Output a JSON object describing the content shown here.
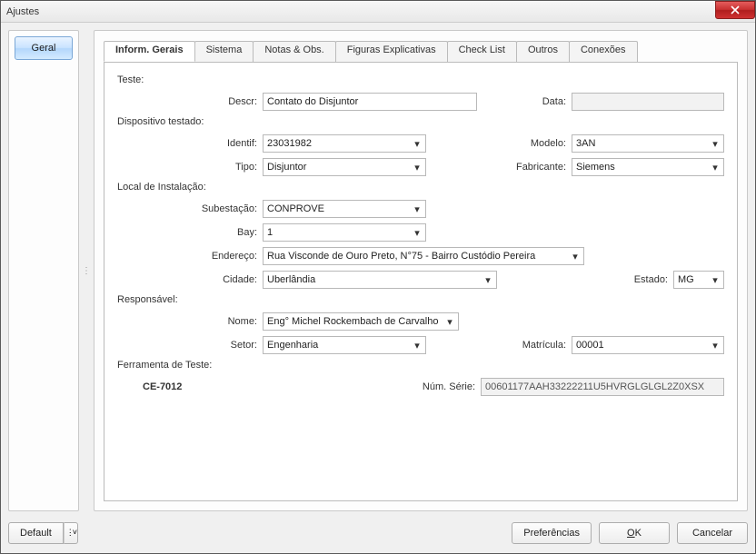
{
  "window": {
    "title": "Ajustes"
  },
  "sidebar": {
    "geral": "Geral"
  },
  "tabs": {
    "inform": "Inform. Gerais",
    "sistema": "Sistema",
    "notas": "Notas & Obs.",
    "figuras": "Figuras Explicativas",
    "check": "Check List",
    "outros": "Outros",
    "conexoes": "Conexões"
  },
  "form": {
    "teste_group": "Teste:",
    "descr_label": "Descr:",
    "descr_value": "Contato do Disjuntor",
    "data_label": "Data:",
    "data_value": "",
    "dispositivo_group": "Dispositivo testado:",
    "identif_label": "Identif:",
    "identif_value": "23031982",
    "modelo_label": "Modelo:",
    "modelo_value": "3AN",
    "tipo_label": "Tipo:",
    "tipo_value": "Disjuntor",
    "fabricante_label": "Fabricante:",
    "fabricante_value": "Siemens",
    "local_group": "Local de Instalação:",
    "subestacao_label": "Subestação:",
    "subestacao_value": "CONPROVE",
    "bay_label": "Bay:",
    "bay_value": "1",
    "endereco_label": "Endereço:",
    "endereco_value": "Rua Visconde de Ouro Preto, N°75 - Bairro Custódio Pereira",
    "cidade_label": "Cidade:",
    "cidade_value": "Uberlândia",
    "estado_label": "Estado:",
    "estado_value": "MG",
    "responsavel_group": "Responsável:",
    "nome_label": "Nome:",
    "nome_value": "Eng° Michel Rockembach de Carvalho",
    "setor_label": "Setor:",
    "setor_value": "Engenharia",
    "matricula_label": "Matrícula:",
    "matricula_value": "00001",
    "ferramenta_group": "Ferramenta de Teste:",
    "ferramenta_name": "CE-7012",
    "numserie_label": "Núm. Série:",
    "numserie_value": "00601177AAH33222211U5HVRGLGLGL2Z0XSX"
  },
  "footer": {
    "default": "Default",
    "preferencias": "Preferências",
    "ok": "OK",
    "cancelar": "Cancelar"
  },
  "chevron": "▾",
  "divider": "⋮"
}
